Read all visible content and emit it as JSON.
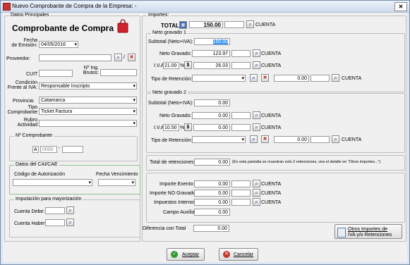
{
  "window": {
    "title": "Nuevo Comprobante de Compra de la Empresa: -"
  },
  "left": {
    "datos_label": "Datos Principales",
    "heading": "Comprobante de Compra",
    "fecha_label_1": "Fecha",
    "fecha_label_2": "de Emisión:",
    "fecha_value": "04/05/2016",
    "proveedor_label": "Proveedor:",
    "slash": "/",
    "cuit_label": "CUIT :",
    "ning_label_1": "Nº Ing.",
    "ning_label_2": "Brutos:",
    "condicion_label_1": "Condición",
    "condicion_label_2": "Frente al IVA:",
    "condicion_value": "Responsable Inscripto",
    "provincia_label": "Provincia:",
    "provincia_value": "Catamarca",
    "tipo_label_1": "Tipo",
    "tipo_label_2": "Comprobante",
    "tipo_value": "Ticket Factura",
    "rubro_label_1": "Rubro",
    "rubro_label_2": "Actividad",
    "rubro_value": "",
    "ncomp_label": "Nº Comprobante",
    "ncomp_letter": "A",
    "ncomp_pv": "0000",
    "ncomp_sep": "-",
    "ncomp_num": "",
    "cai_label": "Datos del CAI/CAE",
    "cod_aut_label": "Código de Autorización",
    "fecha_venc_label": "Fecha Vencimiento",
    "imput_label": "Imputación para mayorización",
    "cuenta_debe_label": "Cuenta Debe:",
    "cuenta_haber_label": "Cuenta Haber:"
  },
  "right": {
    "importes_label": "Importes:",
    "total_label": "TOTAL:",
    "total_value": "150.00",
    "cuenta": "CUENTA",
    "ng1_label": "Neto gravado 1",
    "ng1_subtotal_label": "Subtotal (Neto+IVA):",
    "ng1_subtotal_value": "150.00",
    "ng1_neto_label": "Neto Gravado:",
    "ng1_neto_value": "123.97",
    "ng1_iva_label": "I.V.A",
    "ng1_iva_rate": "21.00",
    "pct": "%",
    "dollar": "$",
    "ng1_iva_value": "26.03",
    "ng1_ret_label": "Tipo de Retención:",
    "ng1_ret_value": "0.00",
    "ng2_label": "Neto gravado 2",
    "ng2_subtotal_label": "Subtotal (Neto+IVA):",
    "ng2_subtotal_value": "0.00",
    "ng2_neto_label": "Neto Gravado:",
    "ng2_neto_value": "0.00",
    "ng2_iva_label": "I.V.A",
    "ng2_iva_rate": "10.50",
    "ng2_iva_value": "0.00",
    "ng2_ret_label": "Tipo de Retención:",
    "ng2_ret_value": "0.00",
    "total_ret_label": "Total de retenciones:",
    "total_ret_value": "0.00",
    "total_ret_note": "(En esta pantalla se muestran solo 2 retenciones, vea el detalle en \"Otros importes...\")",
    "exento_label": "Importe Exento:",
    "exento_value": "0.00",
    "no_grav_label": "Importe NO Gravado:",
    "no_grav_value": "0.00",
    "imp_int_label": "Impuestos Internos:",
    "imp_int_value": "0.00",
    "campo_aux_label": "Campo Auxiliar",
    "campo_aux_value": "0.00",
    "diferencia_label": "Diferencia con Total",
    "diferencia_value": "0.00",
    "otros_line1": "Otros Importes de",
    "otros_line2": "IVA y/o Retenciones"
  },
  "footer": {
    "aceptar": "Aceptar",
    "cancelar": "Cancelar"
  }
}
